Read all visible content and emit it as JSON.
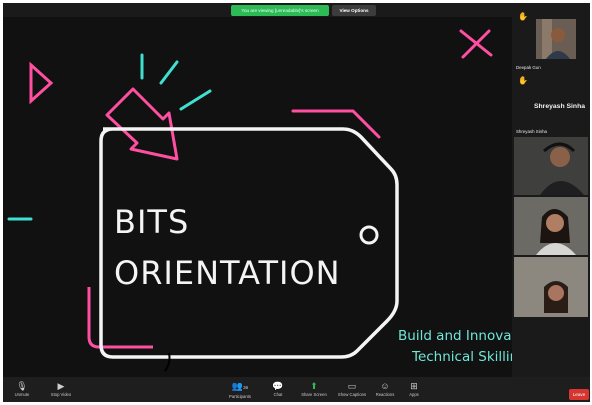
{
  "share_banner": {
    "notice": "You are viewing [unreadable]'s screen",
    "view_options_label": "View Options"
  },
  "slide": {
    "title_line1": "BITS",
    "title_line2": "ORIENTATION",
    "tagline_line1": "Build and Innovate in",
    "tagline_line2": "Technical Skilling",
    "colors": {
      "pink": "#ff4fa0",
      "cyan": "#40e0d0",
      "white": "#f4f4f4"
    }
  },
  "participants": [
    {
      "name": "Deepak Gun",
      "hand_raised": true,
      "video": true
    },
    {
      "name": "Shreyash Sinha",
      "hand_raised": true,
      "video": false
    },
    {
      "name": "",
      "hand_raised": false,
      "video": true
    },
    {
      "name": "",
      "hand_raised": false,
      "video": true
    },
    {
      "name": "",
      "hand_raised": false,
      "video": true
    }
  ],
  "toolbar": {
    "unmute": "Unmute",
    "stop_video": "Stop Video",
    "participants": "Participants",
    "participants_count": "36",
    "chat": "Chat",
    "share_screen": "Share Screen",
    "show_captions": "Show Captions",
    "reactions": "Reactions",
    "apps": "Apps",
    "leave": "Leave",
    "icons": [
      "microphone-muted-icon",
      "video-camera-icon",
      "participants-icon",
      "chat-icon",
      "share-screen-icon",
      "captions-icon",
      "reactions-icon",
      "apps-icon"
    ]
  }
}
